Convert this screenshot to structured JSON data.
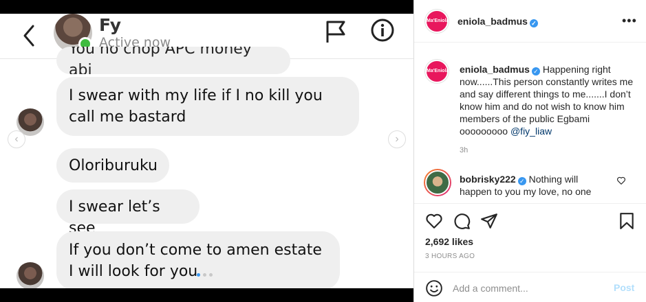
{
  "dm": {
    "name": "Fy",
    "status": "Active now",
    "messages": [
      "You no chop APC money abi",
      "I swear with my life if I no kill you call me bastard",
      "Oloriburuku",
      "I swear let’s see",
      "If you don’t come to amen estate I will look for you"
    ]
  },
  "post": {
    "username": "eniola_badmus",
    "avatar_text": "Ma'Eniola",
    "caption_username": "eniola_badmus",
    "caption": "Happening right now......This person constantly writes me and say different things to me.......I don’t know him and do not wish to know him members of the public Egbami ooooooooo",
    "mention": "@fiy_liaw",
    "caption_time": "3h",
    "comment_username": "bobrisky222",
    "comment_text": "Nothing will happen to you my love, no one",
    "likes": "2,692 likes",
    "posted_ago": "3 HOURS AGO",
    "comment_placeholder": "Add a comment...",
    "post_label": "Post"
  },
  "colors": {
    "brand": "#e8175d",
    "verified": "#3897f0",
    "online": "#3fbb3f",
    "bubble": "#efefef",
    "post_disabled": "#b2dffc"
  }
}
